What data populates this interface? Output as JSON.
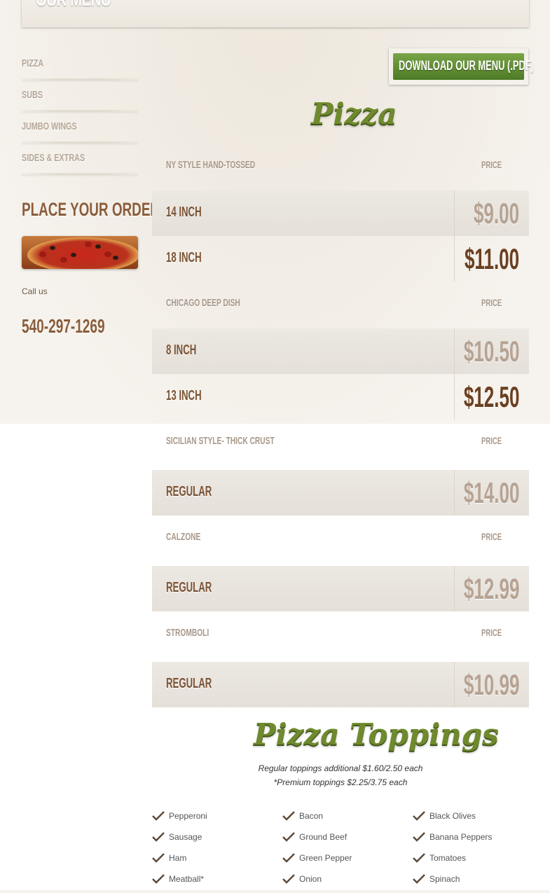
{
  "header": {
    "title": "OUR MENU"
  },
  "sidebar": {
    "items": [
      {
        "label": "PIZZA"
      },
      {
        "label": "SUBS"
      },
      {
        "label": "JUMBO WINGS"
      },
      {
        "label": "SIDES & EXTRAS"
      }
    ],
    "place_order": "PLACE YOUR ORDER",
    "call_us": "Call us",
    "phone": "540-297-1269"
  },
  "download_button": "DOWNLOAD OUR MENU (.PDF)",
  "pizza_title": "Pizza",
  "sections": [
    {
      "name": "NY STYLE HAND-TOSSED",
      "price_label": "PRICE",
      "rows": [
        {
          "size": "14 INCH",
          "price": "$9.00"
        },
        {
          "size": "18 INCH",
          "price": "$11.00"
        }
      ]
    },
    {
      "name": "CHICAGO DEEP DISH",
      "price_label": "PRICE",
      "rows": [
        {
          "size": "8 INCH",
          "price": "$10.50"
        },
        {
          "size": "13 INCH",
          "price": "$12.50"
        }
      ]
    },
    {
      "name": "SICILIAN STYLE- THICK CRUST",
      "price_label": "PRICE",
      "rows": [
        {
          "size": "REGULAR",
          "price": "$14.00"
        }
      ]
    },
    {
      "name": "CALZONE",
      "price_label": "PRICE",
      "rows": [
        {
          "size": "REGULAR",
          "price": "$12.99"
        }
      ]
    },
    {
      "name": "STROMBOLI",
      "price_label": "PRICE",
      "rows": [
        {
          "size": "REGULAR",
          "price": "$10.99"
        }
      ]
    }
  ],
  "toppings": {
    "title": "Pizza Toppings",
    "note1": "Regular toppings additional $1.60/2.50 each",
    "note2": "*Premium toppings $2.25/3.75 each",
    "columns": [
      [
        "Pepperoni",
        "Sausage",
        "Ham",
        "Meatball*"
      ],
      [
        "Bacon",
        "Ground Beef",
        "Green Pepper",
        "Onion"
      ],
      [
        "Black Olives",
        "Banana Peppers",
        "Tomatoes",
        "Spinach"
      ]
    ]
  },
  "colors": {
    "accent_green": "#6f8a2d",
    "brown": "#8b5d3b"
  }
}
